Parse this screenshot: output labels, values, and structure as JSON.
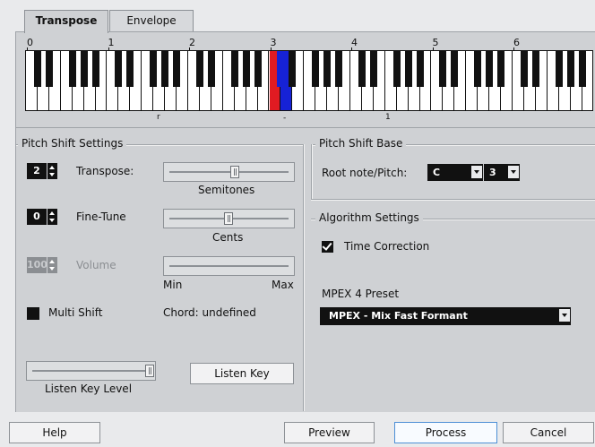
{
  "tabs": {
    "transpose": "Transpose",
    "envelope": "Envelope"
  },
  "keyboard": {
    "octaves": [
      "0",
      "1",
      "2",
      "3",
      "4",
      "5",
      "6"
    ],
    "highlight_red": "#e11b22",
    "highlight_blue": "#1622d6",
    "marker_left": "r",
    "marker_mid": "-",
    "marker_right": "1"
  },
  "pitch_shift": {
    "title": "Pitch Shift Settings",
    "transpose": {
      "value": "2",
      "label": "Transpose:",
      "unit": "Semitones"
    },
    "fine_tune": {
      "value": "0",
      "label": "Fine-Tune",
      "unit": "Cents"
    },
    "volume": {
      "value": "100",
      "label": "Volume",
      "min": "Min",
      "max": "Max"
    },
    "multi_shift": {
      "label": "Multi Shift",
      "chord": "Chord: undefined"
    },
    "listen_key_level": "Listen Key Level",
    "listen_key_button": "Listen Key"
  },
  "pitch_shift_base": {
    "title": "Pitch Shift Base",
    "label": "Root note/Pitch:",
    "note": "C",
    "octave": "3"
  },
  "algorithm": {
    "title": "Algorithm Settings",
    "time_correction": "Time Correction",
    "preset_label": "MPEX 4 Preset",
    "preset_value": "MPEX - Mix Fast Formant"
  },
  "buttons": {
    "help": "Help",
    "preview": "Preview",
    "process": "Process",
    "cancel": "Cancel"
  }
}
